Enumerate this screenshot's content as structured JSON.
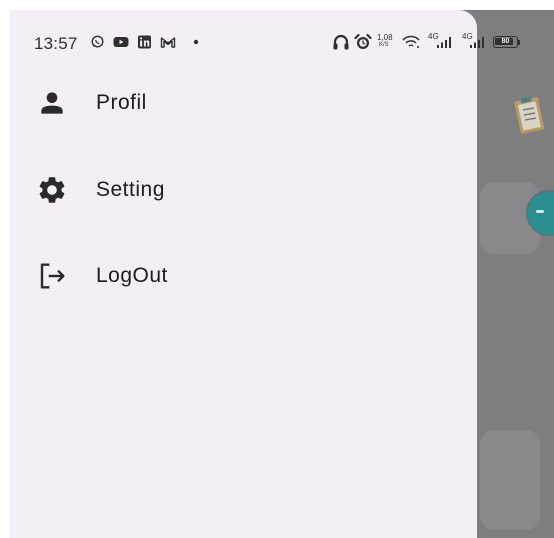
{
  "status_bar": {
    "time": "13:57",
    "network_speed_value": "1,08",
    "network_speed_unit": "K/S",
    "signal_1_label": "4G",
    "signal_2_label": "4G",
    "battery_level": "80"
  },
  "drawer": {
    "items": [
      {
        "label": "Profil",
        "icon": "person-icon"
      },
      {
        "label": "Setting",
        "icon": "gear-icon"
      },
      {
        "label": "LogOut",
        "icon": "logout-icon"
      }
    ]
  },
  "colors": {
    "drawer_background": "#f4eff6",
    "scrim": "#7f7d80",
    "fab_teal": "#2e8f92",
    "text": "#1d1b20"
  }
}
